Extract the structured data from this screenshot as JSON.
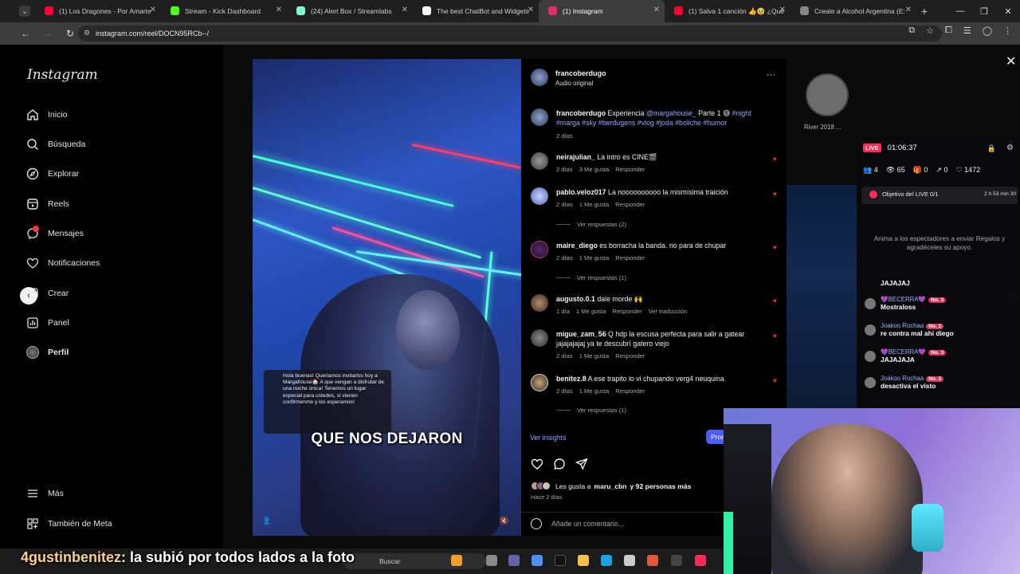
{
  "browser": {
    "tabs": [
      {
        "label": "(1) Los Dragones - Por Amarte",
        "color": "#ff0033"
      },
      {
        "label": "Stream - Kick Dashboard",
        "color": "#53fc18"
      },
      {
        "label": "(24) Alert Box / Streamlabs",
        "color": "#80f5d2"
      },
      {
        "label": "The best ChatBot and Widgets",
        "color": "#ffffff"
      },
      {
        "label": "(1) Instagram",
        "color": "#e1306c"
      },
      {
        "label": "(1) Salva 1 canción 👍🥹 ¿Qué",
        "color": "#ff0033"
      },
      {
        "label": "Create a Alcohol Argentina (E:",
        "color": "#888888"
      }
    ],
    "url": "instagram.com/reel/DOCN95RCb--/"
  },
  "sidebar": {
    "logo": "Instagram",
    "items": [
      {
        "label": "Inicio",
        "icon": "home-icon"
      },
      {
        "label": "Búsqueda",
        "icon": "search-icon"
      },
      {
        "label": "Explorar",
        "icon": "compass-icon"
      },
      {
        "label": "Reels",
        "icon": "reels-icon"
      },
      {
        "label": "Mensajes",
        "icon": "messenger-icon"
      },
      {
        "label": "Notificaciones",
        "icon": "heart-icon"
      },
      {
        "label": "Crear",
        "icon": "plus-icon"
      },
      {
        "label": "Panel",
        "icon": "chart-icon"
      },
      {
        "label": "Perfil",
        "icon": "avatar"
      }
    ],
    "more": "Más",
    "meta": "También de Meta",
    "messages_badge": "1"
  },
  "video": {
    "dm_text": "Hola buenas! Queriamos invitarlos hoy a Margahouse🏠 A que vengan a disfrutar de una noche única! Tenemos un lugar especial para ustedes, si vienen confirmenme y los esperamos!",
    "caption": "QUE NOS DEJARON"
  },
  "post": {
    "author": "francoberdugo",
    "audio": "Audio original",
    "menu": "···",
    "desc_user": "francoberdugo",
    "desc_text": "Experiencia",
    "desc_mention": "@margahouse_",
    "desc_part": "Parte 1 😅",
    "desc_tags_1": "#night",
    "desc_tags_2": "#marga #sky #berdugens #vlog #joda #boliche #humor",
    "desc_time": "2 días"
  },
  "comments": [
    {
      "user": "neirajulian_",
      "text": "La intro es CINE🎬",
      "time": "2 días",
      "likes": "3 Me gusta",
      "reply": "Responder",
      "extra": ""
    },
    {
      "user": "pablo.veloz017",
      "text": "La noooooooooo la mismísima traición",
      "time": "2 días",
      "likes": "1 Me gusta",
      "reply": "Responder",
      "extra": "",
      "replies": "Ver respuestas (2)"
    },
    {
      "user": "maire_diego",
      "text": "es borracha la banda. no para de chupar",
      "time": "2 días",
      "likes": "1 Me gusta",
      "reply": "Responder",
      "extra": "",
      "replies": "Ver respuestas (1)"
    },
    {
      "user": "augusto.0.1",
      "text": "dale morde 🙌",
      "time": "1 día",
      "likes": "1 Me gusta",
      "reply": "Responder",
      "extra": "Ver traducción"
    },
    {
      "user": "migue_zam_56",
      "text": "Q hdp la escusa perfecta para salir a gatear jajajajajaj ya te descubrí gatero viejo",
      "time": "2 días",
      "likes": "1 Me gusta",
      "reply": "Responder",
      "extra": ""
    },
    {
      "user": "benitez.8",
      "text": "A ese trapito lo vi chupando verg4 neuquina",
      "time": "2 días",
      "likes": "1 Me gusta",
      "reply": "Responder",
      "extra": "",
      "replies": "Ver respuestas (1)"
    }
  ],
  "footer": {
    "insights": "Ver insights",
    "promote": "Promocionar",
    "likes_prefix": "Les gusta a",
    "likes_user": "maru_cbn",
    "likes_suffix": "y 92 personas más",
    "ago": "Hace 2 días",
    "add_comment": "Añade un comentario..."
  },
  "right": {
    "preview_label": "River 2018 ..."
  },
  "live": {
    "badge": "LIVE",
    "timer": "01:06:37",
    "stats": [
      "4",
      "65",
      "0",
      "0",
      "1472"
    ],
    "goal_label": "Objetivo del LIVE 0/1",
    "goal_time": "2 h 53 min 30",
    "invite": "Anima a los espectadores a enviar Regalos y agradéceles su apoyo.",
    "chat": [
      {
        "user": "",
        "level": "",
        "msg": "JAJAJAJ"
      },
      {
        "user": "💜BECERRA💜",
        "level": "No. 3",
        "msg": "Mostraloss"
      },
      {
        "user": "Joakoo Rochaa",
        "level": "No. 2",
        "msg": "re contra mal ahi diego"
      },
      {
        "user": "💜BECERRA💜",
        "level": "No. 3",
        "msg": "JAJAJAJA"
      },
      {
        "user": "Joakoo Rochaa",
        "level": "No. 2",
        "msg": "desactiva el visto"
      }
    ]
  },
  "stream_caption": {
    "user": "4gustinbenitez",
    "text": ": la subió por todos lados a la foto"
  },
  "taskbar": {
    "search": "Buscar"
  }
}
